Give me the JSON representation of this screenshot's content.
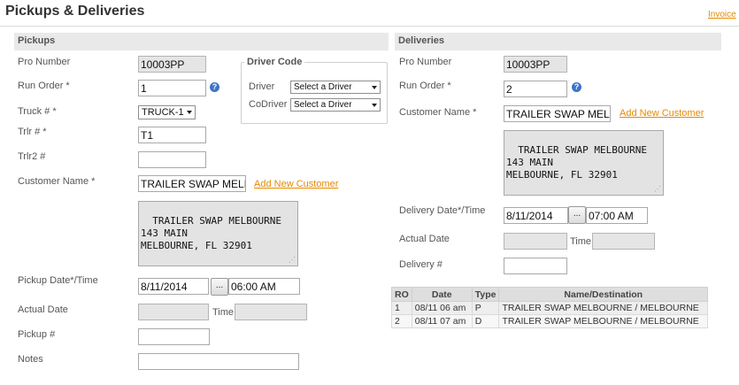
{
  "header": {
    "title": "Pickups & Deliveries",
    "invoice_link": "Invoice"
  },
  "colors": {
    "accent_link": "#e48a00",
    "info_icon": "#3d73c6",
    "section_bg": "#e9e9e9"
  },
  "pickups": {
    "section_title": "Pickups",
    "pro_number": {
      "label": "Pro Number",
      "value": "10003PP"
    },
    "run_order": {
      "label": "Run Order *",
      "value": "1"
    },
    "truck": {
      "label": "Truck # *",
      "value": "TRUCK-1"
    },
    "trlr": {
      "label": "Trlr # *",
      "value": "T1"
    },
    "trlr2": {
      "label": "Trlr2 #",
      "value": ""
    },
    "customer_name": {
      "label": "Customer Name *",
      "value": "TRAILER SWAP MELBOURNE",
      "add_link": "Add New Customer"
    },
    "address": "TRAILER SWAP MELBOURNE\n143 MAIN\nMELBOURNE, FL 32901",
    "pickup_datetime": {
      "label": "Pickup Date*/Time",
      "date": "8/11/2014",
      "time": "06:00 AM",
      "picker": "..."
    },
    "actual_date": {
      "label": "Actual Date",
      "value": "",
      "time_label": "Time",
      "time_value": ""
    },
    "pickup_no": {
      "label": "Pickup #",
      "value": ""
    },
    "notes": {
      "label": "Notes",
      "value": ""
    }
  },
  "driver_code": {
    "legend": "Driver Code",
    "driver": {
      "label": "Driver",
      "value": "Select a Driver"
    },
    "codriver": {
      "label": "CoDriver",
      "value": "Select a Driver"
    }
  },
  "deliveries": {
    "section_title": "Deliveries",
    "pro_number": {
      "label": "Pro Number",
      "value": "10003PP"
    },
    "run_order": {
      "label": "Run Order *",
      "value": "2"
    },
    "customer_name": {
      "label": "Customer Name *",
      "value": "TRAILER SWAP MELBOURNE",
      "add_link": "Add New Customer"
    },
    "address": "TRAILER SWAP MELBOURNE\n143 MAIN\nMELBOURNE, FL 32901",
    "delivery_datetime": {
      "label": "Delivery Date*/Time",
      "date": "8/11/2014",
      "time": "07:00 AM",
      "picker": "..."
    },
    "actual_date": {
      "label": "Actual Date",
      "value": "",
      "time_label": "Time",
      "time_value": ""
    },
    "delivery_no": {
      "label": "Delivery #",
      "value": ""
    }
  },
  "stops_table": {
    "columns": [
      "RO",
      "Date",
      "Type",
      "Name/Destination"
    ],
    "rows": [
      [
        "1",
        "08/11 06 am",
        "P",
        "TRAILER SWAP MELBOURNE / MELBOURNE"
      ],
      [
        "2",
        "08/11 07 am",
        "D",
        "TRAILER SWAP MELBOURNE / MELBOURNE"
      ]
    ]
  }
}
